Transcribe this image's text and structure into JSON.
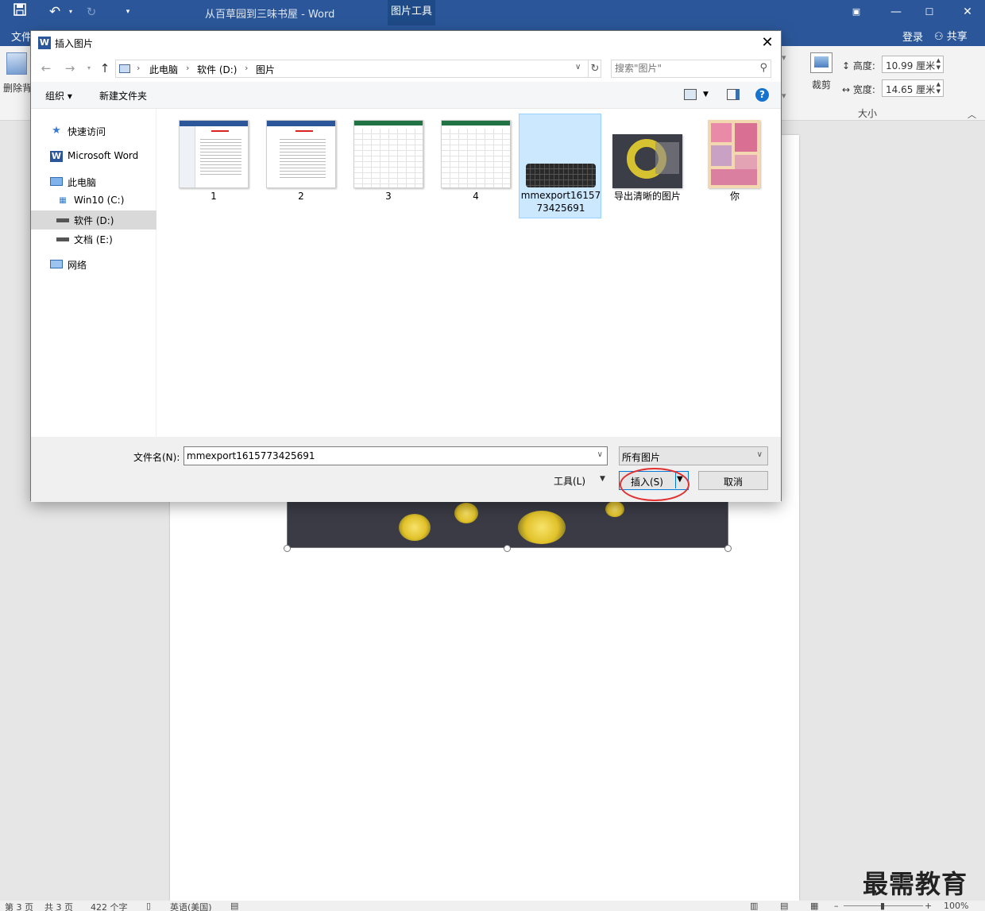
{
  "word": {
    "title": "从百草园到三味书屋 - Word",
    "tool_tab": "图片工具",
    "file_tab": "文件",
    "login": "登录",
    "share": "共享",
    "ribbon": {
      "remove_bg": "删除背",
      "crop": "裁剪",
      "height_label": "高度:",
      "height_value": "10.99 厘米",
      "width_label": "宽度:",
      "width_value": "14.65 厘米",
      "size_group": "大小"
    },
    "status": {
      "page": "第 3 页",
      "total": "共 3 页",
      "words": "422 个字",
      "language": "英语(美国)",
      "zoom": "100%"
    },
    "watermark": "最需教育"
  },
  "dialog": {
    "title": "插入图片",
    "breadcrumb": [
      "此电脑",
      "软件 (D:)",
      "图片"
    ],
    "search_placeholder": "搜索\"图片\"",
    "toolbar": {
      "organize": "组织",
      "new_folder": "新建文件夹"
    },
    "nav": [
      {
        "label": "快速访问"
      },
      {
        "label": "Microsoft Word"
      },
      {
        "label": "此电脑"
      },
      {
        "label": "Win10 (C:)"
      },
      {
        "label": "软件 (D:)"
      },
      {
        "label": "文档 (E:)"
      },
      {
        "label": "网络"
      }
    ],
    "files": [
      {
        "name": "1"
      },
      {
        "name": "2"
      },
      {
        "name": "3"
      },
      {
        "name": "4"
      },
      {
        "name": "mmexport1615773425691"
      },
      {
        "name": "导出清晰的图片"
      },
      {
        "name": "你"
      }
    ],
    "filename_label": "文件名(N):",
    "filename_value": "mmexport1615773425691",
    "filetype": "所有图片",
    "tools": "工具(L)",
    "insert": "插入(S)",
    "cancel": "取消"
  }
}
